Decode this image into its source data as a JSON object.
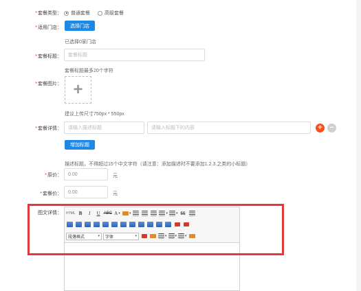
{
  "form": {
    "package_type": {
      "label": "套餐类型：",
      "options": [
        {
          "label": "普通套餐",
          "selected": true
        },
        {
          "label": "高级套餐",
          "selected": false
        }
      ]
    },
    "stores": {
      "label": "适用门店：",
      "button": "选择门店",
      "selected_text": "已选择0家门店"
    },
    "title": {
      "label": "套餐标题：",
      "placeholder": "套餐标题",
      "hint": "套餐标题最多20个字符"
    },
    "image": {
      "label": "套餐图片：",
      "hint": "建议上传尺寸750px * 550px"
    },
    "details": {
      "label": "套餐详情：",
      "title_placeholder": "请输入描述标题",
      "content_placeholder": "请输入标题下的内容",
      "add_title_button": "增加标题",
      "hint": "描述标题，不得超过15个中文字符（请注意：添加描述时不要添加1.2.3.之类的小标题）"
    },
    "original_price": {
      "label": "原价：",
      "value": "0.00",
      "unit": "元"
    },
    "package_price": {
      "label": "套餐价：",
      "value": "0.00",
      "unit": "元"
    },
    "rich_details": {
      "label": "图文详情：",
      "toolbar": {
        "html_label": "HTML",
        "bold": "B",
        "italic": "I",
        "underline": "U",
        "strikethrough": "ABC",
        "font_color": "A",
        "paragraph_format": "段落格式",
        "font_family": "字体",
        "quote": "66"
      }
    }
  },
  "colors": {
    "accent_blue": "#1e88e5",
    "add_orange": "#f4511e",
    "remove_gray": "#cfcfcf",
    "highlight_red": "#e5383b",
    "required_red": "#e22222"
  }
}
